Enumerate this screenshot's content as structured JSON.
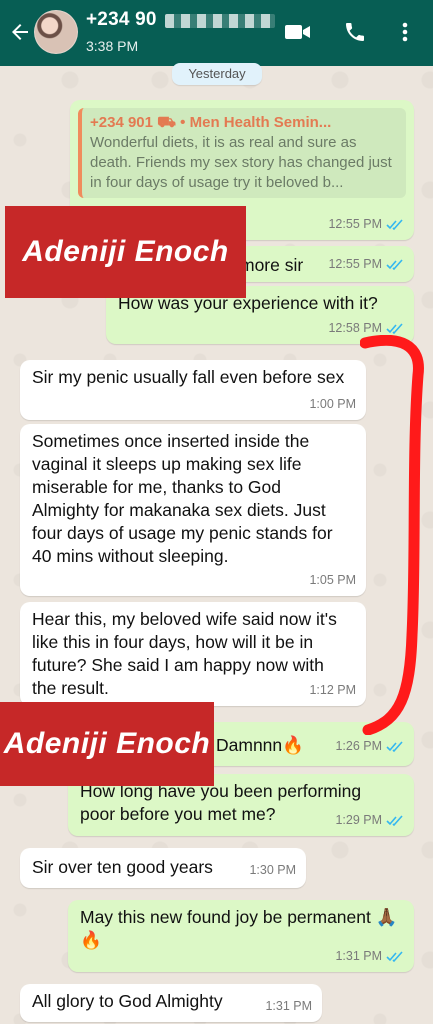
{
  "header": {
    "contact_name": "+234 90",
    "last_seen": "3:38 PM"
  },
  "date_chip": "Yesterday",
  "quoted": {
    "author": "+234 901 ⛟  • Men Health Semin...",
    "text": "Wonderful diets, it is as real and sure as death. Friends my sex story has changed just in four days of usage try it beloved b..."
  },
  "messages": [
    {
      "dir": "out",
      "text": "",
      "time": "12:55 PM"
    },
    {
      "dir": "out",
      "text": "more sir",
      "time": "12:55 PM"
    },
    {
      "dir": "out",
      "text": "How was your experience with it?",
      "time": "12:58 PM"
    },
    {
      "dir": "in",
      "text": "Sir my penic usually fall even before sex",
      "time": "1:00 PM"
    },
    {
      "dir": "in",
      "text": "Sometimes once inserted inside the vaginal it sleeps up making sex life miserable for me, thanks to God Almighty for makanaka sex diets. Just four days of usage my penic stands for 40 mins without sleeping.",
      "time": "1:05 PM"
    },
    {
      "dir": "in",
      "text": "Hear this, my beloved wife said now it's like this in four days, how will it be in future? She said I am happy now with the result.",
      "time": "1:12 PM"
    },
    {
      "dir": "out",
      "text": "Damnnn🔥",
      "time": "1:26 PM"
    },
    {
      "dir": "out",
      "text": "How long have you been performing poor before you met me?",
      "time": "1:29 PM"
    },
    {
      "dir": "in",
      "text": "Sir over ten good years",
      "time": "1:30 PM"
    },
    {
      "dir": "out",
      "text": "May this new found joy be permanent 🙏🏾🔥",
      "time": "1:31 PM"
    },
    {
      "dir": "in",
      "text": "All glory to God Almighty",
      "time": "1:31 PM"
    }
  ],
  "watermarks": [
    "Adeniji Enoch",
    "Adeniji Enoch"
  ],
  "colors": {
    "header": "#075e54",
    "outgoing_bubble": "#dcf8c6",
    "incoming_bubble": "#ffffff",
    "watermark": "#c62828",
    "annotation_stroke": "#ff1a1a"
  },
  "icons": [
    "back-arrow-icon",
    "video-call-icon",
    "phone-icon",
    "more-vert-icon",
    "double-check-icon"
  ]
}
